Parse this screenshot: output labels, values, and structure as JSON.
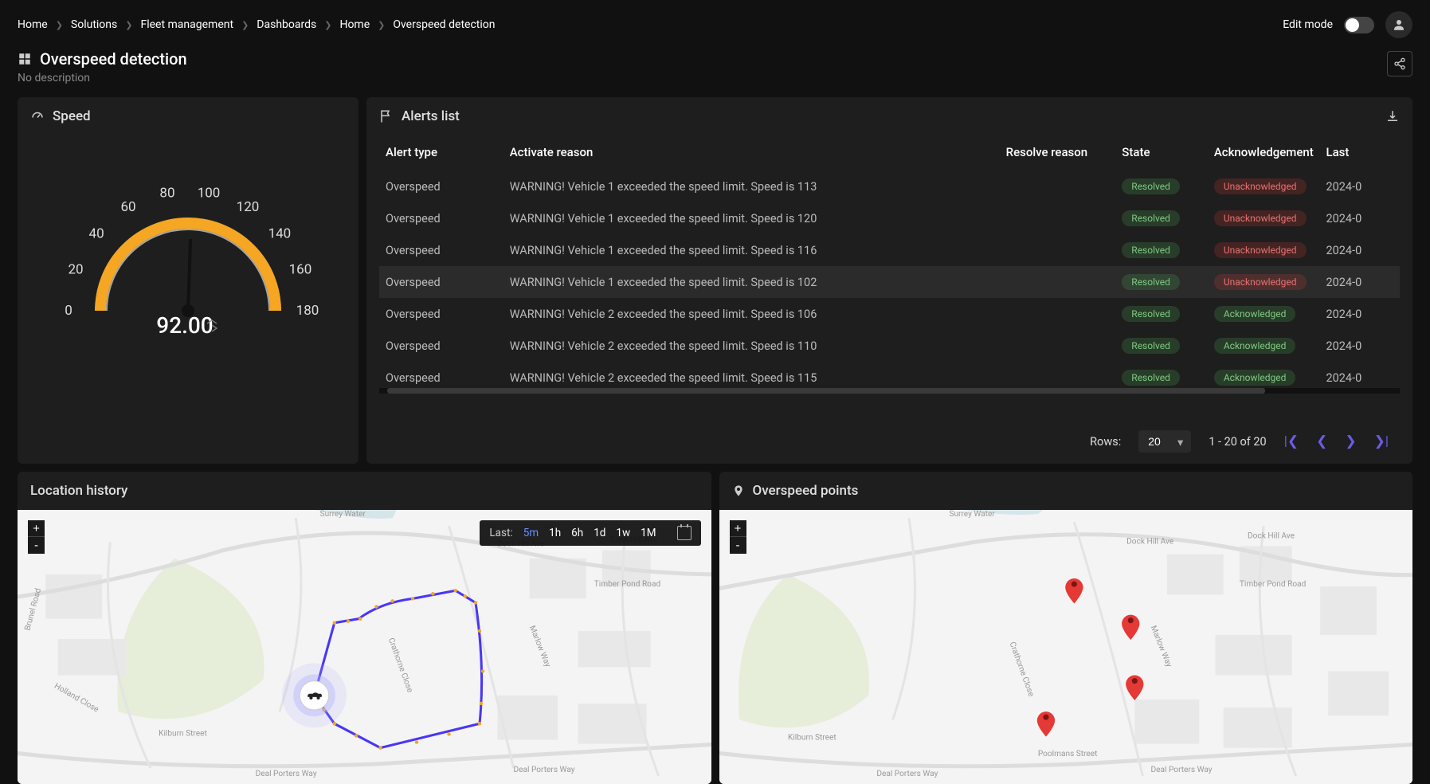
{
  "breadcrumb": [
    "Home",
    "Solutions",
    "Fleet management",
    "Dashboards",
    "Home",
    "Overspeed detection"
  ],
  "header": {
    "edit_mode": "Edit mode"
  },
  "page": {
    "title": "Overspeed detection",
    "description": "No description"
  },
  "speed_panel": {
    "title": "Speed"
  },
  "chart_data": {
    "type": "gauge",
    "value": 92.0,
    "display": "92.00",
    "min": 0,
    "max": 180,
    "ticks": [
      0,
      20,
      40,
      60,
      80,
      100,
      120,
      140,
      160,
      180
    ]
  },
  "alerts_panel": {
    "title": "Alerts list",
    "columns": [
      "Alert type",
      "Activate reason",
      "Resolve reason",
      "State",
      "Acknowledgement",
      "Last"
    ],
    "rows": [
      {
        "type": "Overspeed",
        "activate": "WARNING! Vehicle 1 exceeded the speed limit. Speed is 113",
        "resolve": "",
        "state": "Resolved",
        "ack": "Unacknowledged",
        "last": "2024-0"
      },
      {
        "type": "Overspeed",
        "activate": "WARNING! Vehicle 1 exceeded the speed limit. Speed is 120",
        "resolve": "",
        "state": "Resolved",
        "ack": "Unacknowledged",
        "last": "2024-0"
      },
      {
        "type": "Overspeed",
        "activate": "WARNING! Vehicle 1 exceeded the speed limit. Speed is 116",
        "resolve": "",
        "state": "Resolved",
        "ack": "Unacknowledged",
        "last": "2024-0"
      },
      {
        "type": "Overspeed",
        "activate": "WARNING! Vehicle 1 exceeded the speed limit. Speed is 102",
        "resolve": "",
        "state": "Resolved",
        "ack": "Unacknowledged",
        "last": "2024-0"
      },
      {
        "type": "Overspeed",
        "activate": "WARNING! Vehicle 2 exceeded the speed limit. Speed is 106",
        "resolve": "",
        "state": "Resolved",
        "ack": "Acknowledged",
        "last": "2024-0"
      },
      {
        "type": "Overspeed",
        "activate": "WARNING! Vehicle 2 exceeded the speed limit. Speed is 110",
        "resolve": "",
        "state": "Resolved",
        "ack": "Acknowledged",
        "last": "2024-0"
      },
      {
        "type": "Overspeed",
        "activate": "WARNING! Vehicle 2 exceeded the speed limit. Speed is 115",
        "resolve": "",
        "state": "Resolved",
        "ack": "Acknowledged",
        "last": "2024-0"
      }
    ],
    "pager": {
      "rows_label": "Rows:",
      "rows_value": "20",
      "range": "1 - 20 of 20"
    }
  },
  "location_panel": {
    "title": "Location history",
    "time": {
      "label": "Last:",
      "opts": [
        "5m",
        "1h",
        "6h",
        "1d",
        "1w",
        "1M"
      ],
      "active": "5m"
    }
  },
  "points_panel": {
    "title": "Overspeed points"
  },
  "map_labels": {
    "surrey_water": "Surrey Water",
    "dock_hill": "Dock Hill Ave",
    "dock_hill2": "Dock Hill Ave",
    "timber": "Timber Pond Road",
    "marlow": "Marlow Way",
    "crathorne": "Crathorne Close",
    "kilburn": "Kilburn Street",
    "deal": "Deal Porters Way",
    "deal2": "Deal Porters Way",
    "brunel": "Brunel Road",
    "holland": "Holland Close",
    "poolmans": "Poolmans Street"
  }
}
